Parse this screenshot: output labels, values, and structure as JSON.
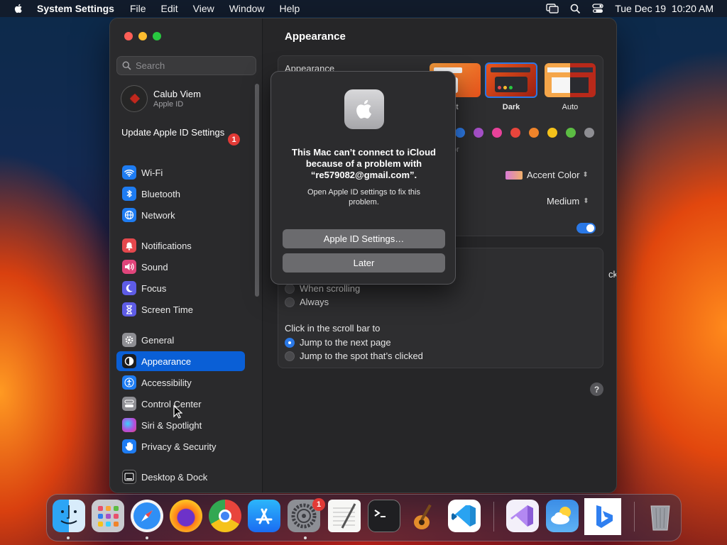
{
  "menubar": {
    "app_name": "System Settings",
    "menus": [
      "File",
      "Edit",
      "View",
      "Window",
      "Help"
    ],
    "datetime": "Tue Dec 19  10:20 AM"
  },
  "sidebar": {
    "search_placeholder": "Search",
    "account": {
      "name": "Calub Viem",
      "sub": "Apple ID"
    },
    "update_label": "Update Apple ID Settings",
    "update_badge": "1",
    "items": [
      {
        "label": "Wi-Fi",
        "icon": "wifi-icon",
        "color": "#1e7cf2"
      },
      {
        "label": "Bluetooth",
        "icon": "bluetooth-icon",
        "color": "#1e7cf2"
      },
      {
        "label": "Network",
        "icon": "globe-icon",
        "color": "#1e7cf2"
      },
      {
        "label": "Notifications",
        "icon": "bell-icon",
        "color": "#e5484d"
      },
      {
        "label": "Sound",
        "icon": "speaker-icon",
        "color": "#e0457b"
      },
      {
        "label": "Focus",
        "icon": "moon-icon",
        "color": "#5e5ce6"
      },
      {
        "label": "Screen Time",
        "icon": "hourglass-icon",
        "color": "#5e5ce6"
      },
      {
        "label": "General",
        "icon": "gear-icon",
        "color": "#8e8e93"
      },
      {
        "label": "Appearance",
        "icon": "appearance-icon",
        "color": "#1c1c1e"
      },
      {
        "label": "Accessibility",
        "icon": "accessibility-icon",
        "color": "#1e7cf2"
      },
      {
        "label": "Control Center",
        "icon": "control-center-icon",
        "color": "#8e8e93"
      },
      {
        "label": "Siri & Spotlight",
        "icon": "siri-icon",
        "color": "#b150e0"
      },
      {
        "label": "Privacy & Security",
        "icon": "hand-icon",
        "color": "#1e7cf2"
      },
      {
        "label": "Desktop & Dock",
        "icon": "dock-icon",
        "color": "#1c1c1e"
      }
    ],
    "active": "Appearance"
  },
  "content": {
    "title": "Appearance",
    "appearance_label": "Appearance",
    "modes": [
      {
        "label": "nt"
      },
      {
        "label": "Dark"
      },
      {
        "label": "Auto"
      }
    ],
    "accent_colors": [
      "#2f7ff0",
      "#a550c8",
      "#e8429a",
      "#e8453c",
      "#f0842a",
      "#f5c21a",
      "#5cbd43",
      "#8e8e93"
    ],
    "accent_fragment": "or",
    "highlight_value": "Accent Color",
    "sidebar_size_value": "Medium",
    "scroll_fragment": "ckpad",
    "show_scroll_options": [
      "When scrolling",
      "Always"
    ],
    "click_label": "Click in the scroll bar to",
    "click_options": [
      "Jump to the next page",
      "Jump to the spot that’s clicked"
    ],
    "help": "?"
  },
  "alert": {
    "title": "This Mac can’t connect to iCloud because of a problem with “re579082@gmail.com”.",
    "message": "Open Apple ID settings to fix this problem.",
    "primary_button": "Apple ID Settings…",
    "secondary_button": "Later"
  },
  "dock": {
    "apps": [
      {
        "name": "Finder",
        "icon": "finder-icon"
      },
      {
        "name": "Launchpad",
        "icon": "launchpad-icon"
      },
      {
        "name": "Safari",
        "icon": "safari-icon"
      },
      {
        "name": "Firefox",
        "icon": "firefox-icon"
      },
      {
        "name": "Chrome",
        "icon": "chrome-icon"
      },
      {
        "name": "App Store",
        "icon": "app-store-icon"
      },
      {
        "name": "System Settings",
        "icon": "system-settings-icon",
        "badge": "1"
      },
      {
        "name": "TextEdit",
        "icon": "textedit-icon"
      },
      {
        "name": "Terminal",
        "icon": "terminal-icon"
      },
      {
        "name": "GarageBand",
        "icon": "garageband-icon"
      },
      {
        "name": "Visual Studio Code",
        "icon": "vscode-icon"
      },
      {
        "name": "Visual Studio",
        "icon": "visual-studio-icon"
      },
      {
        "name": "Weather",
        "icon": "weather-icon"
      },
      {
        "name": "Bing",
        "icon": "bing-icon"
      },
      {
        "name": "Trash",
        "icon": "trash-icon"
      }
    ]
  }
}
